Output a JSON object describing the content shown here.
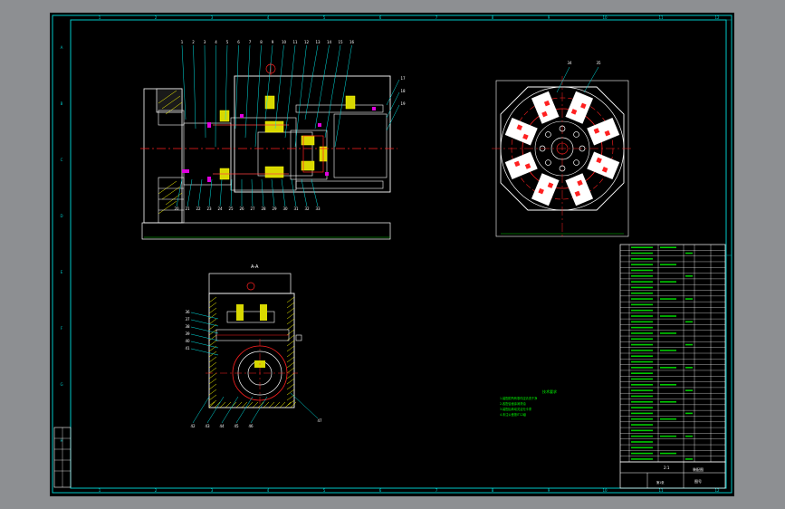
{
  "app": {
    "title": "",
    "tabs": []
  },
  "drawing": {
    "title_block_text": {
      "scale": "2:1",
      "drawing_title": "装配图",
      "drawing_no": "图号",
      "sheet": "第1张"
    },
    "view_labels": {
      "section_top": "A-A",
      "notes_title": "技术要求",
      "notes": [
        "1.装配前所有零件应清洗干净",
        "2.各配合面涂润滑油",
        "3.装配后转动灵活无卡滞",
        "4.未注公差按IT12级"
      ]
    },
    "balloons_top": [
      "1",
      "2",
      "3",
      "4",
      "5",
      "6",
      "7",
      "8",
      "9",
      "10",
      "11",
      "12",
      "13",
      "14",
      "15",
      "16"
    ],
    "balloons_side_right": [
      "17",
      "18",
      "19"
    ],
    "balloons_bottom": [
      "20",
      "21",
      "22",
      "23",
      "24",
      "25",
      "26",
      "27",
      "28",
      "29",
      "30",
      "31",
      "32",
      "33"
    ],
    "balloons_round": [
      "34",
      "35"
    ],
    "balloons_section": [
      "36",
      "37",
      "38",
      "39",
      "40",
      "41",
      "42",
      "43",
      "44",
      "45",
      "46",
      "47"
    ],
    "border_col_labels": [
      "1",
      "2",
      "3",
      "4",
      "5",
      "6",
      "7",
      "8",
      "9",
      "10",
      "11",
      "12"
    ],
    "border_row_labels": [
      "A",
      "B",
      "C",
      "D",
      "E",
      "F",
      "G",
      "H"
    ],
    "bom_rows": 38,
    "colors": {
      "border": "#00c8c8",
      "geometry": "#ffffff",
      "hatch": "#ffff00",
      "leader": "#00e0e0",
      "center": "#ff2020",
      "dim": "#00ff00",
      "part": "#ff00ff"
    }
  }
}
